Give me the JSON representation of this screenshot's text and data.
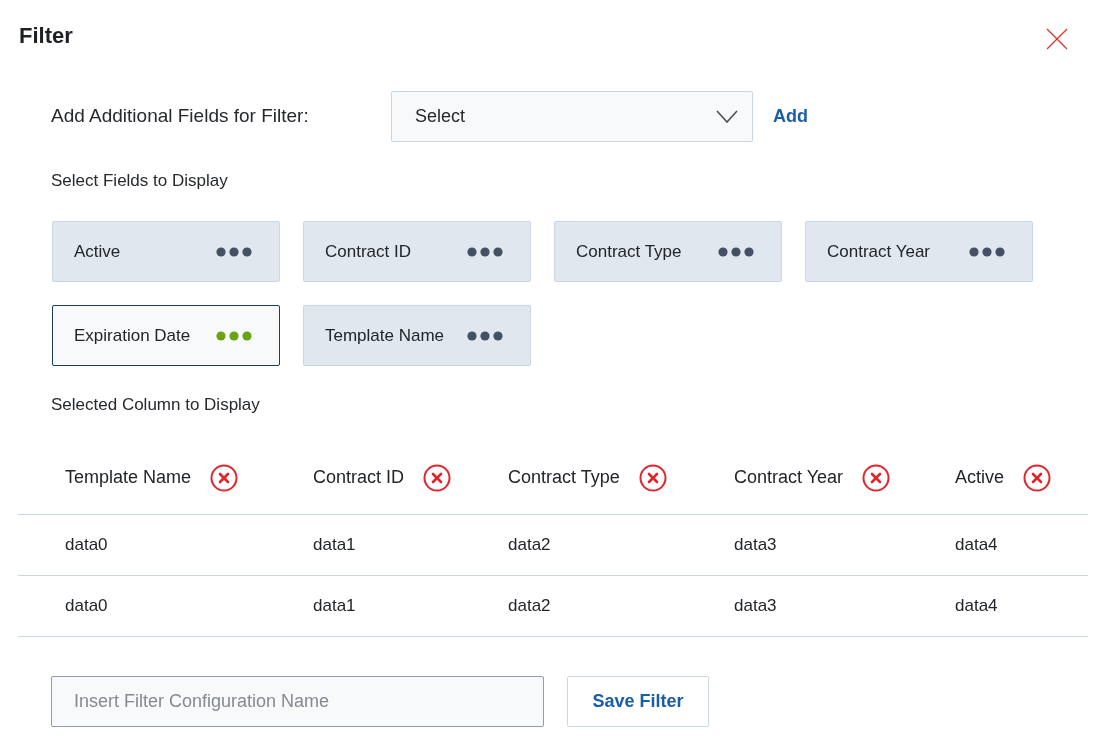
{
  "dialog": {
    "title": "Filter"
  },
  "add_fields": {
    "label": "Add Additional Fields for Filter:",
    "select": {
      "value": "Select"
    },
    "add_link": "Add"
  },
  "display_fields": {
    "heading": "Select Fields to Display",
    "chips": [
      {
        "label": "Active",
        "selected": false
      },
      {
        "label": "Contract ID",
        "selected": false
      },
      {
        "label": "Contract Type",
        "selected": false
      },
      {
        "label": "Contract Year",
        "selected": false
      },
      {
        "label": "Expiration Date",
        "selected": true
      },
      {
        "label": "Template Name",
        "selected": false
      }
    ]
  },
  "selected_columns": {
    "heading": "Selected Column to Display",
    "columns": [
      "Template Name",
      "Contract ID",
      "Contract Type",
      "Contract Year",
      "Active"
    ],
    "rows": [
      [
        "data0",
        "data1",
        "data2",
        "data3",
        "data4"
      ],
      [
        "data0",
        "data1",
        "data2",
        "data3",
        "data4"
      ]
    ]
  },
  "config_name": {
    "placeholder": "Insert Filter Configuration Name"
  },
  "save_button": "Save Filter"
}
